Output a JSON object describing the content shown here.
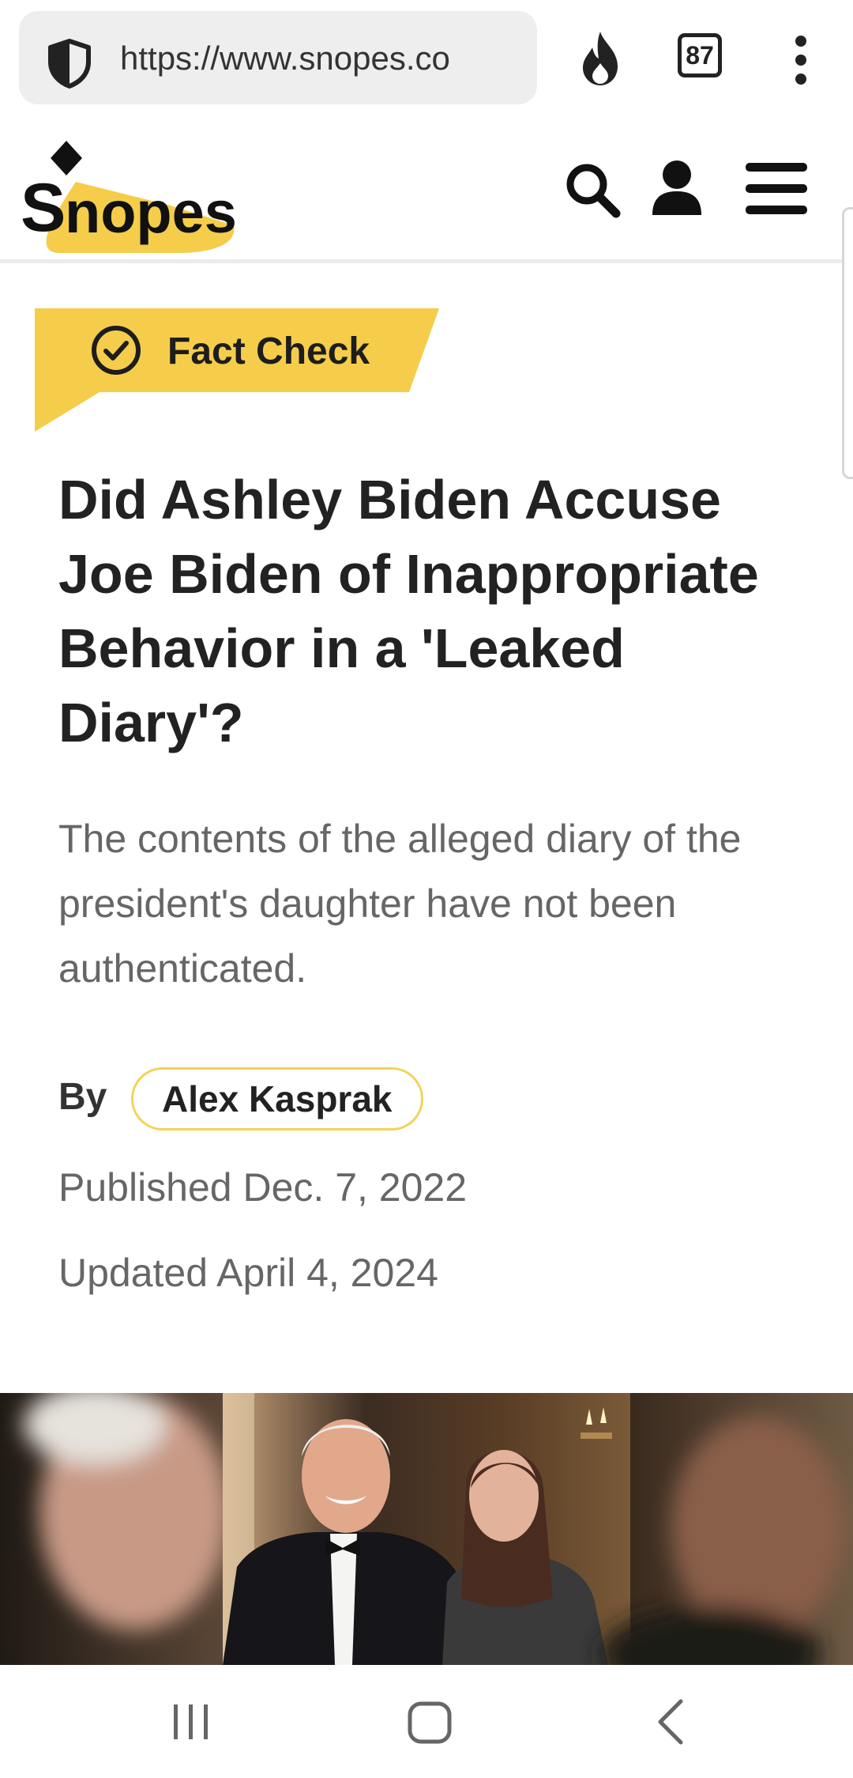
{
  "browser": {
    "url": "https://www.snopes.co",
    "tab_count": "87",
    "icons": {
      "site_security": "shield-icon",
      "trending": "fire-icon",
      "menu": "more-vert-icon"
    }
  },
  "site": {
    "logo_text": "Snopes",
    "brand_color": "#f5cd4b",
    "icons": {
      "search": "search-icon",
      "account": "person-icon",
      "menu": "hamburger-icon"
    }
  },
  "article": {
    "badge": "Fact Check",
    "headline": "Did Ashley Biden Accuse Joe Biden of Inappropriate Behavior in a 'Leaked Diary'?",
    "subheadline": "The contents of the alleged diary of the president's daughter have not been authenticated.",
    "by_label": "By",
    "author": "Alex Kasprak",
    "published": "Published Dec. 7, 2022",
    "updated": "Updated April 4, 2024"
  },
  "system_nav": {
    "icons": {
      "recents": "recents-icon",
      "home": "home-icon",
      "back": "back-icon"
    }
  }
}
